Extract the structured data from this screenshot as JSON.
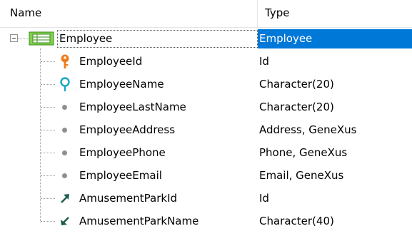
{
  "header": {
    "name": "Name",
    "type": "Type"
  },
  "colors": {
    "selection": "#0078d7",
    "key": "#f07c1c",
    "index": "#17a7c6",
    "fk": "#1d5c4f",
    "dot": "#8f8f8f"
  },
  "root": {
    "name": "Employee",
    "type": "Employee",
    "icon": "entity-table-icon"
  },
  "rows": [
    {
      "name": "EmployeeId",
      "type": "Id",
      "icon": "primary-key-icon"
    },
    {
      "name": "EmployeeName",
      "type": "Character(20)",
      "icon": "index-key-icon"
    },
    {
      "name": "EmployeeLastName",
      "type": "Character(20)",
      "icon": "attribute-dot-icon"
    },
    {
      "name": "EmployeeAddress",
      "type": "Address, GeneXus",
      "icon": "attribute-dot-icon"
    },
    {
      "name": "EmployeePhone",
      "type": "Phone, GeneXus",
      "icon": "attribute-dot-icon"
    },
    {
      "name": "EmployeeEmail",
      "type": "Email, GeneXus",
      "icon": "attribute-dot-icon"
    },
    {
      "name": "AmusementParkId",
      "type": "Id",
      "icon": "foreign-key-up-icon"
    },
    {
      "name": "AmusementParkName",
      "type": "Character(40)",
      "icon": "foreign-key-down-icon"
    }
  ]
}
